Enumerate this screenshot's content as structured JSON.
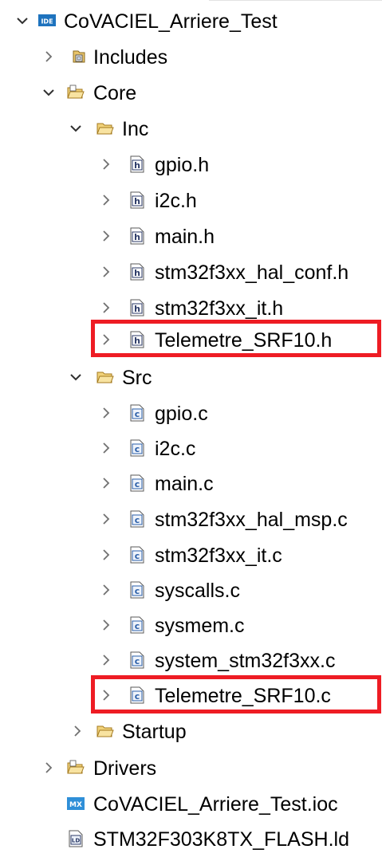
{
  "colors": {
    "highlight_border": "#ee1c24",
    "ide_badge": "#1e73be",
    "mx_badge": "#2f8fd8",
    "folder": "#d9a441"
  },
  "tree": {
    "project": {
      "label": "CoVACIEL_Arriere_Test",
      "icon": "ide-project-icon",
      "badge": "IDE"
    },
    "includes": {
      "label": "Includes",
      "icon": "includes-icon"
    },
    "core": {
      "label": "Core",
      "icon": "source-folder-icon"
    },
    "inc": {
      "label": "Inc",
      "icon": "folder-icon"
    },
    "inc_files": [
      {
        "label": "gpio.h",
        "icon": "header-file-icon",
        "badge": "h"
      },
      {
        "label": "i2c.h",
        "icon": "header-file-icon",
        "badge": "h"
      },
      {
        "label": "main.h",
        "icon": "header-file-icon",
        "badge": "h"
      },
      {
        "label": "stm32f3xx_hal_conf.h",
        "icon": "header-file-icon",
        "badge": "h"
      },
      {
        "label": "stm32f3xx_it.h",
        "icon": "header-file-icon",
        "badge": "h"
      },
      {
        "label": "Telemetre_SRF10.h",
        "icon": "header-file-icon",
        "badge": "h"
      }
    ],
    "src": {
      "label": "Src",
      "icon": "folder-icon"
    },
    "src_files": [
      {
        "label": "gpio.c",
        "icon": "c-file-icon",
        "badge": "c"
      },
      {
        "label": "i2c.c",
        "icon": "c-file-icon",
        "badge": "c"
      },
      {
        "label": "main.c",
        "icon": "c-file-icon",
        "badge": "c"
      },
      {
        "label": "stm32f3xx_hal_msp.c",
        "icon": "c-file-icon",
        "badge": "c"
      },
      {
        "label": "stm32f3xx_it.c",
        "icon": "c-file-icon",
        "badge": "c"
      },
      {
        "label": "syscalls.c",
        "icon": "c-file-icon",
        "badge": "c"
      },
      {
        "label": "sysmem.c",
        "icon": "c-file-icon",
        "badge": "c"
      },
      {
        "label": "system_stm32f3xx.c",
        "icon": "c-file-icon",
        "badge": "c"
      },
      {
        "label": "Telemetre_SRF10.c",
        "icon": "c-file-icon",
        "badge": "c"
      }
    ],
    "startup": {
      "label": "Startup",
      "icon": "folder-icon"
    },
    "drivers": {
      "label": "Drivers",
      "icon": "source-folder-icon"
    },
    "ioc": {
      "label": "CoVACIEL_Arriere_Test.ioc",
      "icon": "mx-file-icon",
      "badge": "MX"
    },
    "ld": {
      "label": "STM32F303K8TX_FLASH.ld",
      "icon": "linker-file-icon",
      "badge": "LD"
    }
  }
}
